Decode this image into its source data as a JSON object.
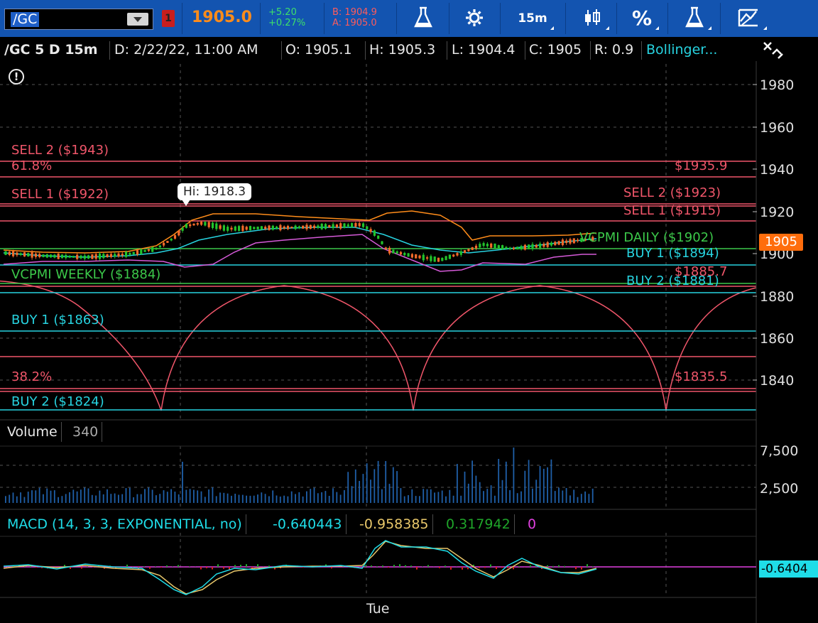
{
  "toolbar": {
    "symbol": "/GC",
    "flag_num": "1",
    "last": "1905.0",
    "change_abs": "+5.20",
    "change_pct": "+0.27%",
    "bid": "B: 1904.9",
    "ask": "A: 1905.0",
    "timeframe": "15m",
    "percent": "%"
  },
  "info": {
    "title": "/GC 5 D 15m",
    "date": "D: 2/22/22, 11:00 AM",
    "open": "O: 1905.1",
    "high": "H: 1905.3",
    "low": "L: 1904.4",
    "close": "C: 1905",
    "range": "R: 0.9",
    "study": "Bollinger..."
  },
  "price_axis": {
    "ticks": [
      "1980",
      "1960",
      "1940",
      "1920",
      "1900",
      "1880",
      "1860",
      "1840"
    ],
    "current": "1905"
  },
  "levels": {
    "sell2_left": "SELL 2 ($1943)",
    "fib618": "61.8%",
    "fib_top_right": "$1935.9",
    "sell1_left": "SELL 1 ($1922)",
    "sell2_right": "SELL 2  ($1923)",
    "sell1_right": "SELL 1  ($1915)",
    "vcpmi_daily": "VCPMI DAILY ($1902)",
    "buy1_right": "BUY 1  ($1894)",
    "vcpmi_weekly": "VCPMI WEEKLY ($1884)",
    "fib_mid_right": "$1885.7",
    "buy2_right": "BUY 2  ($1881)",
    "buy1_left": "BUY 1 ($1863)",
    "fib382": "38.2%",
    "fib_bottom_right": "$1835.5",
    "buy2_left": "BUY 2 ($1824)",
    "hi_tooltip": "Hi: 1918.3"
  },
  "volume": {
    "label": "Volume",
    "value": "340",
    "ticks": [
      "7,500",
      "2,500"
    ]
  },
  "macd": {
    "label": "MACD (14, 3, 3, EXPONENTIAL, no)",
    "value": "-0.640443",
    "avg": "-0.958385",
    "diff": "0.317942",
    "zero": "0",
    "tag": "-0.6404"
  },
  "time_axis": {
    "label": "Tue"
  },
  "colors": {
    "toolbar_bg": "#1354b0",
    "sell": "#f0566a",
    "buy": "#27d3e0",
    "vcpmi": "#3cc84a",
    "price_tag": "#ff6d0c",
    "macd_line": "#1fdde8",
    "macd_avg": "#e8c76a",
    "diff_pos": "#1fa52a",
    "diff_neg": "#d82020",
    "zero_line": "#e040e0"
  }
}
